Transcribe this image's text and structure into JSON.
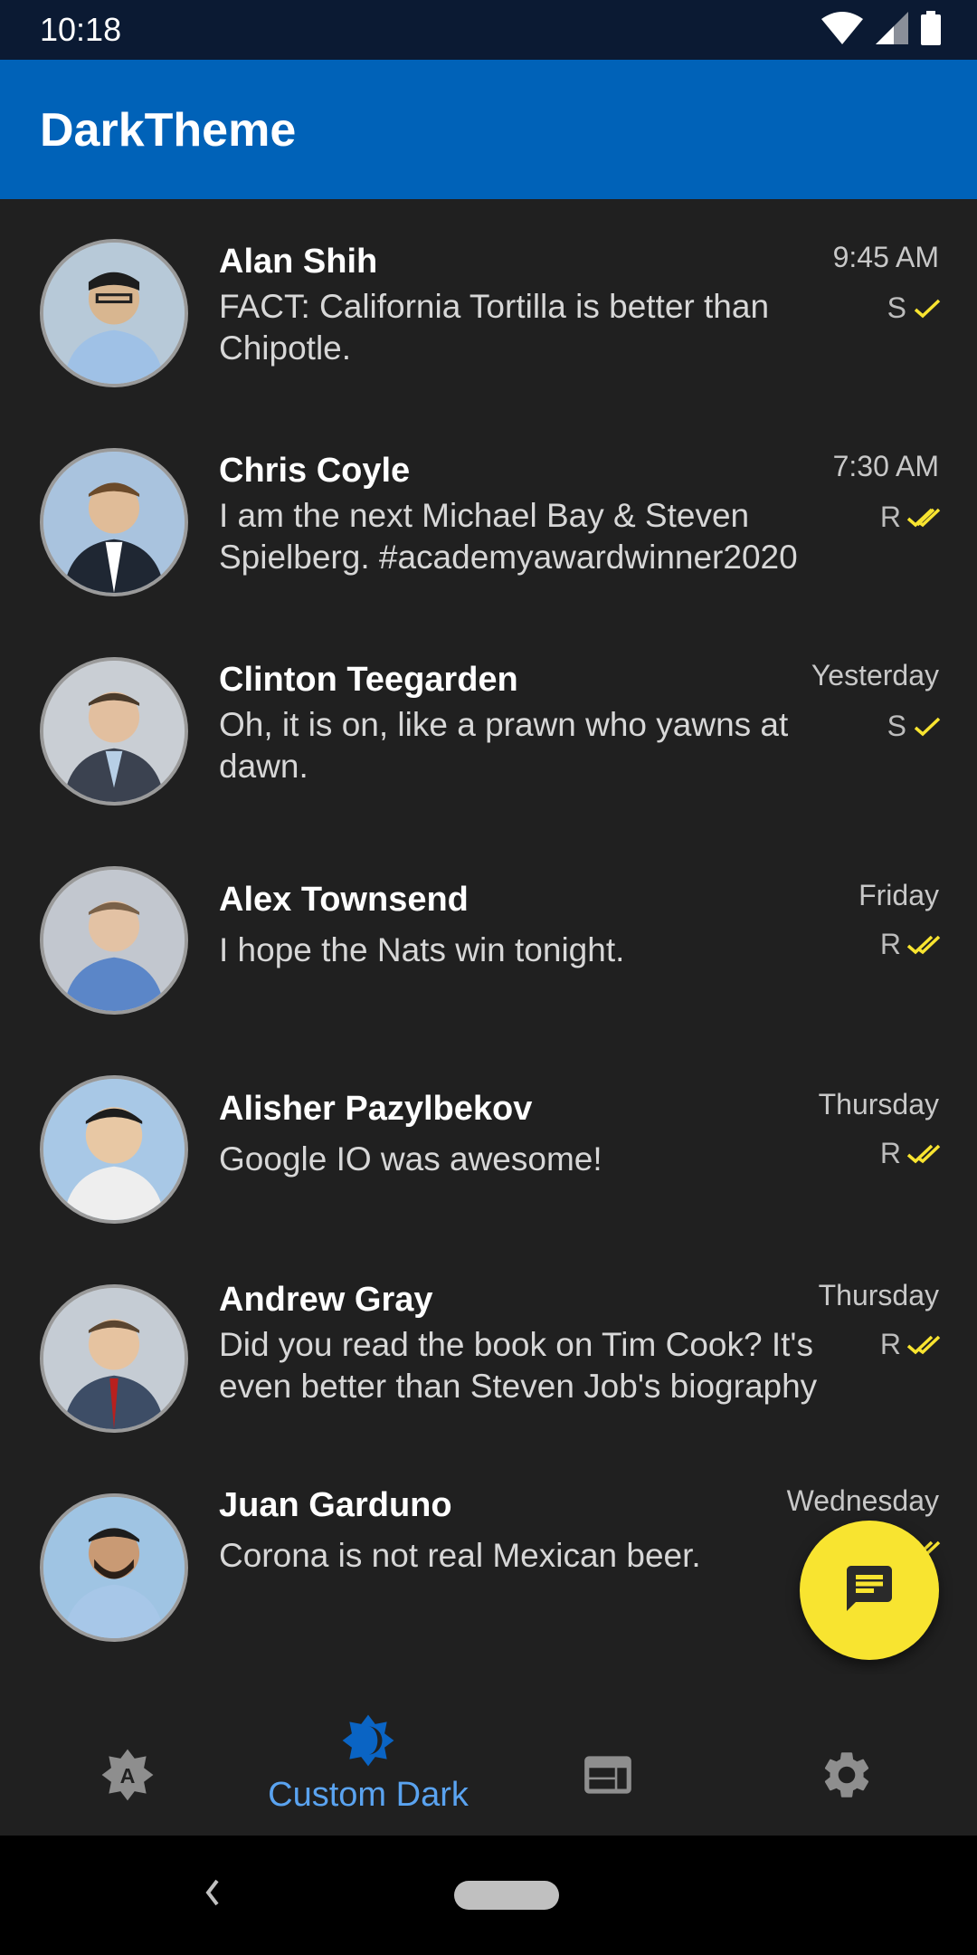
{
  "status_bar": {
    "time": "10:18",
    "icons": [
      "wifi-icon",
      "cell-signal-icon",
      "battery-icon"
    ]
  },
  "app_bar": {
    "title": "DarkTheme"
  },
  "conversations": [
    {
      "name": "Alan Shih",
      "message": "FACT: California Tortilla is better than Chipotle.",
      "time": "9:45 AM",
      "status": "S",
      "check": "single"
    },
    {
      "name": "Chris Coyle",
      "message": "I am the next Michael Bay & Steven Spielberg. #academyawardwinner2020",
      "time": "7:30 AM",
      "status": "R",
      "check": "double"
    },
    {
      "name": "Clinton Teegarden",
      "message": "Oh, it is on, like a prawn who yawns at dawn.",
      "time": "Yesterday",
      "status": "S",
      "check": "single"
    },
    {
      "name": "Alex Townsend",
      "message": "I hope the Nats win tonight.",
      "time": "Friday",
      "status": "R",
      "check": "double"
    },
    {
      "name": "Alisher Pazylbekov",
      "message": "Google IO was awesome!",
      "time": "Thursday",
      "status": "R",
      "check": "double"
    },
    {
      "name": "Andrew Gray",
      "message": "Did you read the book on Tim Cook? It's even better than Steven Job's biography",
      "time": "Thursday",
      "status": "R",
      "check": "double"
    },
    {
      "name": "Juan Garduno",
      "message": "Corona is not real Mexican beer.",
      "time": "Wednesday",
      "status": "R",
      "check": "double"
    }
  ],
  "fab": {
    "icon": "message-icon"
  },
  "bottom_nav": {
    "items": [
      {
        "icon": "auto-theme-icon",
        "label": ""
      },
      {
        "icon": "brightness-icon",
        "label": "Custom Dark",
        "active": true
      },
      {
        "icon": "web-icon",
        "label": ""
      },
      {
        "icon": "gear-icon",
        "label": ""
      }
    ]
  },
  "colors": {
    "accent": "#0062b8",
    "fab": "#f8e430",
    "check": "#f8e430",
    "active_label": "#5aa3f0",
    "background": "#202020"
  }
}
